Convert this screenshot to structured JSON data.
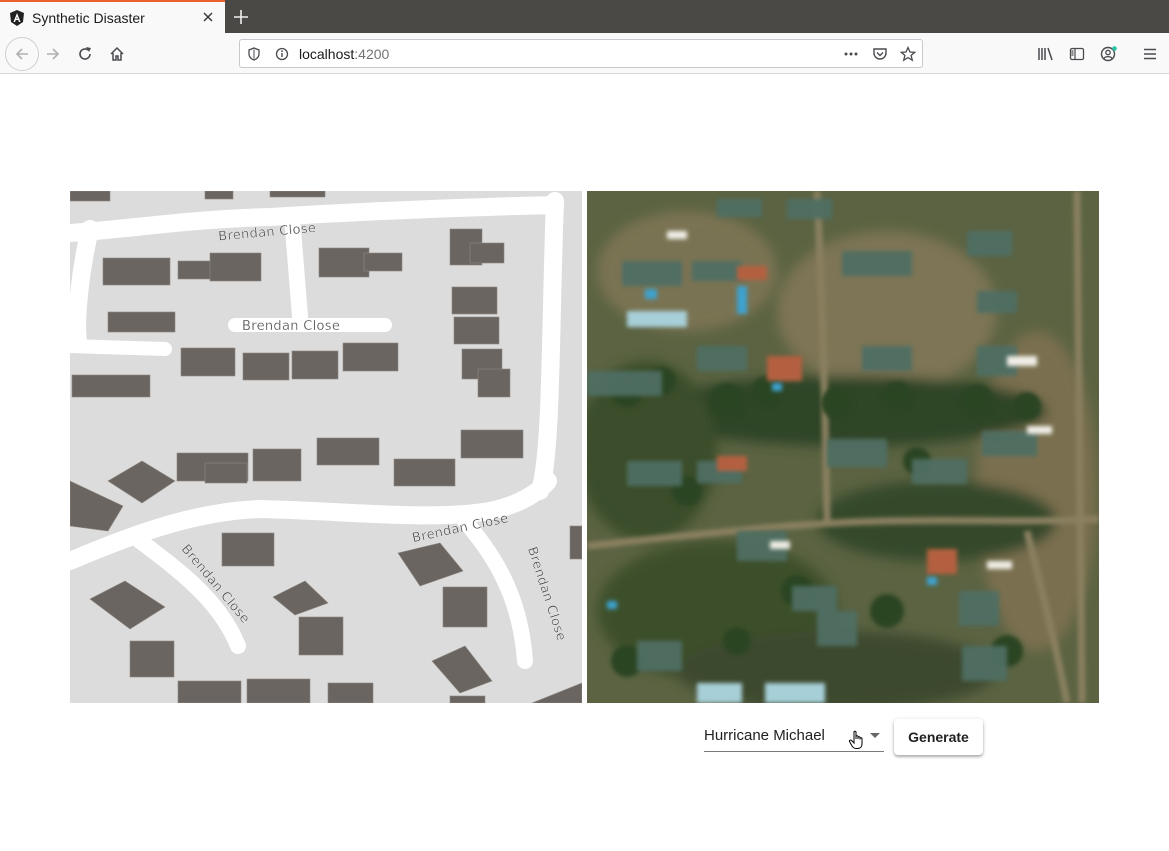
{
  "browser": {
    "tab_title": "Synthetic Disaster",
    "url_host": "localhost",
    "url_port": ":4200"
  },
  "map": {
    "street_labels": [
      "Brendan Close",
      "Brendan Close",
      "Brendan Close",
      "Brendan Close",
      "Brendan Close"
    ]
  },
  "controls": {
    "disaster_select_value": "Hurricane Michael",
    "generate_label": "Generate"
  },
  "colors": {
    "tab_accent": "#e8602c",
    "map_background": "#dcdcdc",
    "building": "#6b6561",
    "road": "#ffffff"
  }
}
